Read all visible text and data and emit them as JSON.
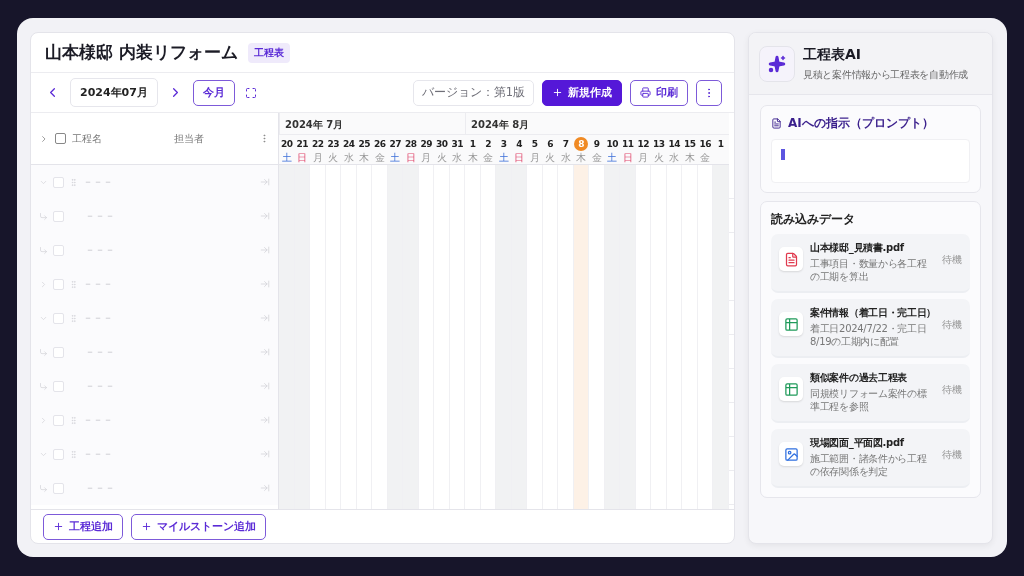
{
  "title": "山本様邸 内装リフォーム",
  "title_tag": "工程表",
  "toolbar": {
    "month": "2024年07月",
    "today_button": "今月",
    "version": "バージョン：第1版",
    "new_button": "新規作成",
    "print_button": "印刷"
  },
  "table": {
    "columns": [
      "工程名",
      "担当者"
    ],
    "all_checked": false,
    "rows": [
      {
        "kind": "parent",
        "expanded": true,
        "checked": false,
        "name": "－－－"
      },
      {
        "kind": "child",
        "checked": false,
        "name": "－－－"
      },
      {
        "kind": "child",
        "checked": false,
        "name": "－－－"
      },
      {
        "kind": "parent",
        "expanded": false,
        "checked": false,
        "name": "－－－"
      },
      {
        "kind": "parent",
        "expanded": true,
        "checked": false,
        "name": "－－－"
      },
      {
        "kind": "child",
        "checked": false,
        "name": "－－－"
      },
      {
        "kind": "child",
        "checked": false,
        "name": "－－－"
      },
      {
        "kind": "parent",
        "expanded": false,
        "checked": false,
        "name": "－－－"
      },
      {
        "kind": "parent",
        "expanded": true,
        "checked": false,
        "name": "－－－"
      },
      {
        "kind": "child",
        "checked": false,
        "name": "－－－"
      }
    ]
  },
  "timeline": {
    "months": [
      {
        "label": "2024年 7月",
        "days": [
          {
            "date": "20",
            "weekday": "土",
            "kind": "saturday",
            "today": false
          },
          {
            "date": "21",
            "weekday": "日",
            "kind": "sunday",
            "today": false
          },
          {
            "date": "22",
            "weekday": "月",
            "kind": "weekday",
            "today": false
          },
          {
            "date": "23",
            "weekday": "火",
            "kind": "weekday",
            "today": false
          },
          {
            "date": "24",
            "weekday": "水",
            "kind": "weekday",
            "today": false
          },
          {
            "date": "25",
            "weekday": "木",
            "kind": "weekday",
            "today": false
          },
          {
            "date": "26",
            "weekday": "金",
            "kind": "weekday",
            "today": false
          },
          {
            "date": "27",
            "weekday": "土",
            "kind": "saturday",
            "today": false
          },
          {
            "date": "28",
            "weekday": "日",
            "kind": "sunday",
            "today": false
          },
          {
            "date": "29",
            "weekday": "月",
            "kind": "weekday",
            "today": false
          },
          {
            "date": "30",
            "weekday": "火",
            "kind": "weekday",
            "today": false
          },
          {
            "date": "31",
            "weekday": "水",
            "kind": "weekday",
            "today": false
          }
        ]
      },
      {
        "label": "2024年 8月",
        "days": [
          {
            "date": "1",
            "weekday": "木",
            "kind": "weekday",
            "today": false
          },
          {
            "date": "2",
            "weekday": "金",
            "kind": "weekday",
            "today": false
          },
          {
            "date": "3",
            "weekday": "土",
            "kind": "saturday",
            "today": false
          },
          {
            "date": "4",
            "weekday": "日",
            "kind": "sunday",
            "today": false
          },
          {
            "date": "5",
            "weekday": "月",
            "kind": "weekday",
            "today": false
          },
          {
            "date": "6",
            "weekday": "火",
            "kind": "weekday",
            "today": false
          },
          {
            "date": "7",
            "weekday": "水",
            "kind": "weekday",
            "today": false
          },
          {
            "date": "8",
            "weekday": "木",
            "kind": "weekday",
            "today": true
          },
          {
            "date": "9",
            "weekday": "金",
            "kind": "weekday",
            "today": false
          },
          {
            "date": "10",
            "weekday": "土",
            "kind": "saturday",
            "today": false
          },
          {
            "date": "11",
            "weekday": "日",
            "kind": "sunday",
            "today": false
          },
          {
            "date": "12",
            "weekday": "月",
            "kind": "weekday",
            "today": false
          },
          {
            "date": "13",
            "weekday": "火",
            "kind": "weekday",
            "today": false
          },
          {
            "date": "14",
            "weekday": "水",
            "kind": "weekday",
            "today": false
          },
          {
            "date": "15",
            "weekday": "木",
            "kind": "weekday",
            "today": false
          },
          {
            "date": "16",
            "weekday": "金",
            "kind": "weekday",
            "today": false
          },
          {
            "date": "1",
            "kind": "saturday",
            "today": false
          }
        ]
      }
    ]
  },
  "footer_buttons": [
    "工程追加",
    "マイルストーン追加"
  ],
  "ai_panel": {
    "title": "工程表AI",
    "subtitle": "見積と案件情報から工程表を自動作成",
    "prompt": {
      "heading": "AIへの指示（プロンプト）"
    },
    "sources": {
      "heading": "読み込みデータ",
      "items": [
        {
          "kind": "pdf",
          "name": "山本様邸_見積書.pdf",
          "description": "工事項目・数量から各工程の工期を算出",
          "status": "待機"
        },
        {
          "kind": "table",
          "name": "案件情報（着工日・完工日）",
          "description": "着工日2024/7/22・完工日8/19の工期内に配置",
          "status": "待機"
        },
        {
          "kind": "table",
          "name": "類似案件の過去工程表",
          "description": "同規模リフォーム案件の標準工程を参照",
          "status": "待機"
        },
        {
          "kind": "image",
          "name": "現場図面_平面図.pdf",
          "description": "施工範囲・諸条件から工程の依存関係を判定",
          "status": "待機"
        }
      ]
    }
  }
}
